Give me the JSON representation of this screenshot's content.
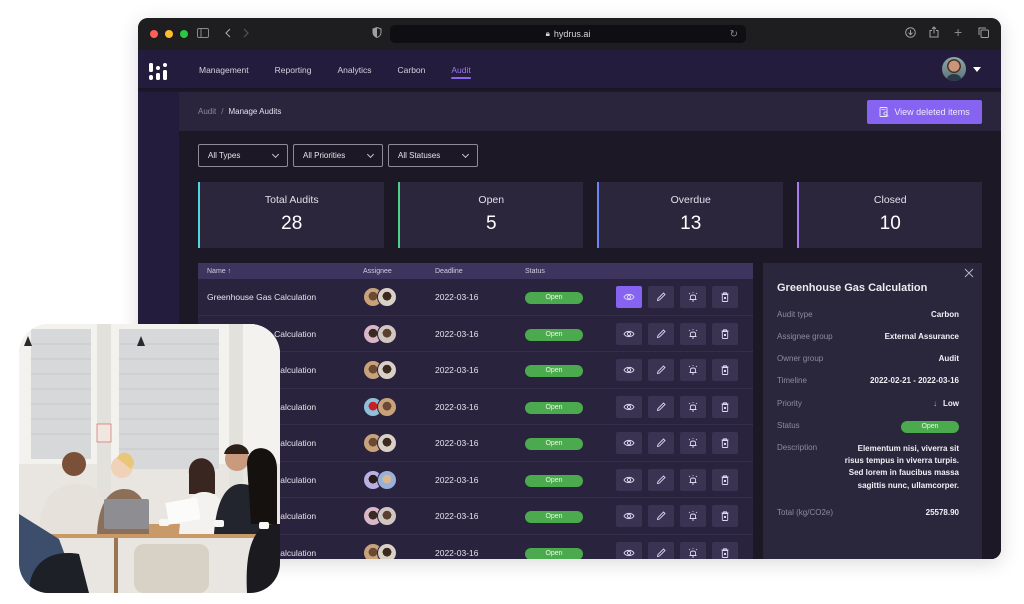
{
  "browser": {
    "url": "hydrus.ai",
    "traffic_lights": [
      "#ff5f57",
      "#febc2e",
      "#28c840"
    ],
    "icons": [
      "sidebar-toggle-icon",
      "back-icon",
      "forward-icon",
      "privacy-shield-icon",
      "lock-icon",
      "reload-icon",
      "download-icon",
      "share-icon",
      "new-tab-icon",
      "tabs-overview-icon"
    ]
  },
  "nav": {
    "items": [
      {
        "label": "Management",
        "active": false
      },
      {
        "label": "Reporting",
        "active": false
      },
      {
        "label": "Analytics",
        "active": false
      },
      {
        "label": "Carbon",
        "active": false
      },
      {
        "label": "Audit",
        "active": true
      }
    ]
  },
  "breadcrumb": {
    "parent": "Audit",
    "separator": "/",
    "current": "Manage Audits"
  },
  "toolbar": {
    "view_deleted_label": "View deleted items"
  },
  "filters": [
    {
      "value": "All Types"
    },
    {
      "value": "All Priorities"
    },
    {
      "value": "All Statuses"
    }
  ],
  "stats": [
    {
      "label": "Total Audits",
      "value": "28",
      "color": "#4fd6e0"
    },
    {
      "label": "Open",
      "value": "5",
      "color": "#4fd08a"
    },
    {
      "label": "Overdue",
      "value": "13",
      "color": "#6b86f0"
    },
    {
      "label": "Closed",
      "value": "10",
      "color": "#a77ef0"
    }
  ],
  "table": {
    "columns": {
      "name": "Name",
      "sort_icon": "↑",
      "assignee": "Assignee",
      "deadline": "Deadline",
      "status": "Status"
    },
    "rows": [
      {
        "name": "Greenhouse Gas Calculation",
        "deadline": "2022-03-16",
        "status": "Open"
      },
      {
        "name": "Greenhouse Gas Calculation",
        "deadline": "2022-03-16",
        "status": "Open"
      },
      {
        "name": "Greenhouse Gas Calculation",
        "deadline": "2022-03-16",
        "status": "Open"
      },
      {
        "name": "Greenhouse Gas Calculation",
        "deadline": "2022-03-16",
        "status": "Open"
      },
      {
        "name": "Greenhouse Gas Calculation",
        "deadline": "2022-03-16",
        "status": "Open"
      },
      {
        "name": "Greenhouse Gas Calculation",
        "deadline": "2022-03-16",
        "status": "Open"
      },
      {
        "name": "Greenhouse Gas Calculation",
        "deadline": "2022-03-16",
        "status": "Open"
      },
      {
        "name": "Greenhouse Gas Calculation",
        "deadline": "2022-03-16",
        "status": "Open"
      }
    ]
  },
  "detail": {
    "title": "Greenhouse Gas Calculation",
    "fields": {
      "audit_type": {
        "label": "Audit type",
        "value": "Carbon"
      },
      "assignee_group": {
        "label": "Assignee group",
        "value": "External Assurance"
      },
      "owner_group": {
        "label": "Owner group",
        "value": "Audit"
      },
      "timeline": {
        "label": "Timeline",
        "value": "2022-02-21 - 2022-03-16"
      },
      "priority": {
        "label": "Priority",
        "value": "Low",
        "icon": "↓"
      },
      "status": {
        "label": "Status",
        "value": "Open"
      },
      "description": {
        "label": "Description",
        "value": "Elementum nisi, viverra sit risus tempus in viverra turpis. Sed lorem in faucibus massa sagittis nunc, ullamcorper."
      },
      "total": {
        "label": "Total (kg/CO2e)",
        "value": "25578.90"
      }
    }
  },
  "colors": {
    "accent": "#8663f0",
    "status_open": "#4caa4e",
    "nav_bg": "#241c3d",
    "page_bg": "#1c1825"
  }
}
